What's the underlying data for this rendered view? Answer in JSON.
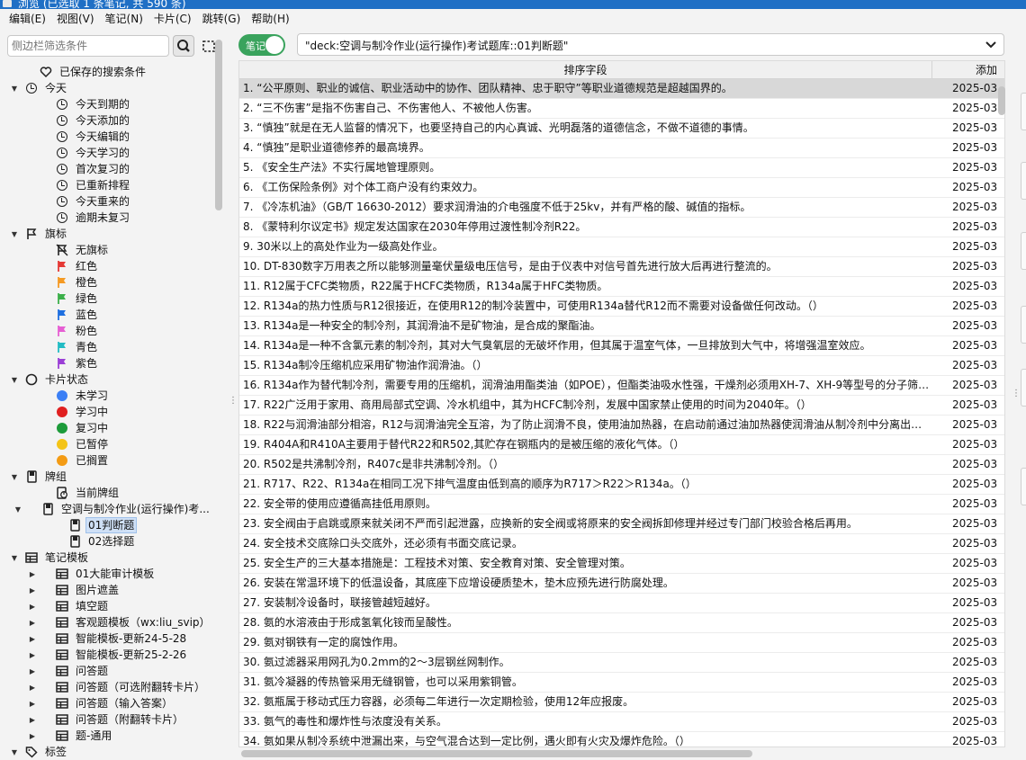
{
  "window": {
    "title": "浏览 (已选取 1 条笔记, 共 590 条)"
  },
  "menu": [
    "编辑(E)",
    "视图(V)",
    "笔记(N)",
    "卡片(C)",
    "跳转(G)",
    "帮助(H)"
  ],
  "sidebar": {
    "search_placeholder": "侧边栏筛选条件",
    "items": [
      {
        "label": "已保存的搜索条件",
        "icon": "heart-icon",
        "arrow": ""
      },
      {
        "label": "今天",
        "icon": "clock-icon",
        "arrow": "down"
      },
      {
        "label": "今天到期的",
        "icon": "clock-icon",
        "arrow": ""
      },
      {
        "label": "今天添加的",
        "icon": "clock-icon",
        "arrow": ""
      },
      {
        "label": "今天编辑的",
        "icon": "clock-icon",
        "arrow": ""
      },
      {
        "label": "今天学习的",
        "icon": "clock-icon",
        "arrow": ""
      },
      {
        "label": "首次复习的",
        "icon": "clock-icon",
        "arrow": ""
      },
      {
        "label": "已重新排程",
        "icon": "clock-icon",
        "arrow": ""
      },
      {
        "label": "今天重来的",
        "icon": "clock-icon",
        "arrow": ""
      },
      {
        "label": "逾期未复习",
        "icon": "clock-icon",
        "arrow": ""
      },
      {
        "label": "旗标",
        "icon": "flag-outline-icon",
        "arrow": "down"
      },
      {
        "label": "无旗标",
        "icon": "flag-off-icon",
        "arrow": ""
      },
      {
        "label": "红色",
        "icon": "flag-red-icon",
        "arrow": "",
        "color": "#e53935"
      },
      {
        "label": "橙色",
        "icon": "flag-orange-icon",
        "arrow": "",
        "color": "#f59a23"
      },
      {
        "label": "绿色",
        "icon": "flag-green-icon",
        "arrow": "",
        "color": "#3cb04a"
      },
      {
        "label": "蓝色",
        "icon": "flag-blue-icon",
        "arrow": "",
        "color": "#1e6fe0"
      },
      {
        "label": "粉色",
        "icon": "flag-pink-icon",
        "arrow": "",
        "color": "#e65fd3"
      },
      {
        "label": "青色",
        "icon": "flag-cyan-icon",
        "arrow": "",
        "color": "#22bcc4"
      },
      {
        "label": "紫色",
        "icon": "flag-purple-icon",
        "arrow": "",
        "color": "#9b3fd6"
      },
      {
        "label": "卡片状态",
        "icon": "circle-icon",
        "arrow": "down"
      },
      {
        "label": "未学习",
        "icon": "dot-blue-icon",
        "arrow": "",
        "color": "#3b7ff5"
      },
      {
        "label": "学习中",
        "icon": "dot-red-icon",
        "arrow": "",
        "color": "#e02020"
      },
      {
        "label": "复习中",
        "icon": "dot-green-icon",
        "arrow": "",
        "color": "#1d9b3a"
      },
      {
        "label": "已暂停",
        "icon": "dot-yellow-icon",
        "arrow": "",
        "color": "#f4c417"
      },
      {
        "label": "已搁置",
        "icon": "dot-orange-icon",
        "arrow": "",
        "color": "#f39b14"
      },
      {
        "label": "牌组",
        "icon": "deck-icon",
        "arrow": "down"
      },
      {
        "label": "当前牌组",
        "icon": "current-deck-icon",
        "arrow": ""
      },
      {
        "label": "空调与制冷作业(运行操作)考...",
        "icon": "deck-icon",
        "arrow": "down"
      },
      {
        "label": "01判断题",
        "icon": "deck-icon",
        "arrow": "",
        "selected": true
      },
      {
        "label": "02选择题",
        "icon": "deck-icon",
        "arrow": ""
      },
      {
        "label": "笔记模板",
        "icon": "notetype-icon",
        "arrow": "down"
      },
      {
        "label": "01大能审计模板",
        "icon": "notetype-icon",
        "arrow": "right"
      },
      {
        "label": "图片遮盖",
        "icon": "notetype-icon",
        "arrow": "right"
      },
      {
        "label": "填空题",
        "icon": "notetype-icon",
        "arrow": "right"
      },
      {
        "label": "客观题模板（wx:liu_svip）",
        "icon": "notetype-icon",
        "arrow": "right"
      },
      {
        "label": "智能模板-更新24-5-28",
        "icon": "notetype-icon",
        "arrow": "right"
      },
      {
        "label": "智能模板-更新25-2-26",
        "icon": "notetype-icon",
        "arrow": "right"
      },
      {
        "label": "问答题",
        "icon": "notetype-icon",
        "arrow": "right"
      },
      {
        "label": "问答题（可选附翻转卡片）",
        "icon": "notetype-icon",
        "arrow": "right"
      },
      {
        "label": "问答题（输入答案）",
        "icon": "notetype-icon",
        "arrow": "right"
      },
      {
        "label": "问答题（附翻转卡片）",
        "icon": "notetype-icon",
        "arrow": "right"
      },
      {
        "label": "题-通用",
        "icon": "notetype-icon",
        "arrow": "right"
      },
      {
        "label": "标签",
        "icon": "tag-icon",
        "arrow": "down"
      }
    ]
  },
  "toolbar": {
    "mode_label": "笔记",
    "search_value": "\"deck:空调与制冷作业(运行操作)考试题库::01判断题\""
  },
  "table": {
    "columns": [
      "排序字段",
      "添加"
    ],
    "rows": [
      {
        "sort": "1. “公平原则、职业的诚信、职业活动中的协作、团队精神、忠于职守”等职业道德规范是超越国界的。",
        "added": "2025-03",
        "selected": true
      },
      {
        "sort": "2. “三不伤害”是指不伤害自己、不伤害他人、不被他人伤害。",
        "added": "2025-03"
      },
      {
        "sort": "3. “慎独”就是在无人监督的情况下，也要坚持自己的内心真诚、光明磊落的道德信念，不做不道德的事情。",
        "added": "2025-03"
      },
      {
        "sort": "4. “慎独”是职业道德修养的最高境界。",
        "added": "2025-03"
      },
      {
        "sort": "5. 《安全生产法》不实行属地管理原则。",
        "added": "2025-03"
      },
      {
        "sort": "6. 《工伤保险条例》对个体工商户没有约束效力。",
        "added": "2025-03"
      },
      {
        "sort": "7. 《冷冻机油》（GB/T 16630-2012）要求润滑油的介电强度不低于25kv，并有严格的酸、碱值的指标。",
        "added": "2025-03"
      },
      {
        "sort": "8. 《蒙特利尔议定书》规定发达国家在2030年停用过渡性制冷剂R22。",
        "added": "2025-03"
      },
      {
        "sort": "9. 30米以上的高处作业为一级高处作业。",
        "added": "2025-03"
      },
      {
        "sort": "10. DT-830数字万用表之所以能够测量毫伏量级电压信号，是由于仪表中对信号首先进行放大后再进行整流的。",
        "added": "2025-03"
      },
      {
        "sort": "11. R12属于CFC类物质，R22属于HCFC类物质，R134a属于HFC类物质。",
        "added": "2025-03"
      },
      {
        "sort": "12. R134a的热力性质与R12很接近，在使用R12的制冷装置中，可使用R134a替代R12而不需要对设备做任何改动。（）",
        "added": "2025-03"
      },
      {
        "sort": "13. R134a是一种安全的制冷剂，其润滑油不是矿物油，是合成的聚酯油。",
        "added": "2025-03"
      },
      {
        "sort": "14. R134a是一种不含氯元素的制冷剂，其对大气臭氧层的无破坏作用，但其属于温室气体，一旦排放到大气中，将增强温室效应。",
        "added": "2025-03"
      },
      {
        "sort": "15. R134a制冷压缩机应采用矿物油作润滑油。（）",
        "added": "2025-03"
      },
      {
        "sort": "16. R134a作为替代制冷剂，需要专用的压缩机，润滑油用酯类油（如POE），但酯类油吸水性强，干燥剂必须用XH-7、XH-9等型号的分子筛…",
        "added": "2025-03"
      },
      {
        "sort": "17. R22广泛用于家用、商用局部式空调、冷水机组中，其为HCFC制冷剂，发展中国家禁止使用的时间为2040年。（）",
        "added": "2025-03"
      },
      {
        "sort": "18. R22与润滑油部分相溶，R12与润滑油完全互溶，为了防止润滑不良，使用油加热器，在启动前通过油加热器使润滑油从制冷剂中分离出来。",
        "added": "2025-03"
      },
      {
        "sort": "19. R404A和R410A主要用于替代R22和R502,其贮存在钢瓶内的是被压缩的液化气体。（）",
        "added": "2025-03"
      },
      {
        "sort": "20. R502是共沸制冷剂，R407c是非共沸制冷剂。（）",
        "added": "2025-03"
      },
      {
        "sort": "21. R717、R22、R134a在相同工况下排气温度由低到高的顺序为R717＞R22＞R134a。（）",
        "added": "2025-03"
      },
      {
        "sort": "22. 安全带的使用应遵循高挂低用原则。",
        "added": "2025-03"
      },
      {
        "sort": "23. 安全阀由于启跳或原来就关闭不严而引起泄露，应换新的安全阀或将原来的安全阀拆卸修理并经过专门部门校验合格后再用。",
        "added": "2025-03"
      },
      {
        "sort": "24. 安全技术交底除口头交底外，还必须有书面交底记录。",
        "added": "2025-03"
      },
      {
        "sort": "25. 安全生产的三大基本措施是：工程技术对策、安全教育对策、安全管理对策。",
        "added": "2025-03"
      },
      {
        "sort": "26. 安装在常温环境下的低温设备，其底座下应增设硬质垫木，垫木应预先进行防腐处理。",
        "added": "2025-03"
      },
      {
        "sort": "27. 安装制冷设备时，联接管越短越好。",
        "added": "2025-03"
      },
      {
        "sort": "28. 氨的水溶液由于形成氢氧化铵而呈酸性。",
        "added": "2025-03"
      },
      {
        "sort": "29. 氨对钢铁有一定的腐蚀作用。",
        "added": "2025-03"
      },
      {
        "sort": "30. 氨过滤器采用网孔为0.2mm的2～3层钢丝网制作。",
        "added": "2025-03"
      },
      {
        "sort": "31. 氨冷凝器的传热管采用无缝钢管，也可以采用紫铜管。",
        "added": "2025-03"
      },
      {
        "sort": "32. 氨瓶属于移动式压力容器，必须每二年进行一次定期检验，使用12年应报废。",
        "added": "2025-03"
      },
      {
        "sort": "33. 氨气的毒性和爆炸性与浓度没有关系。",
        "added": "2025-03"
      },
      {
        "sort": "34. 氨如果从制冷系统中泄漏出来，与空气混合达到一定比例，遇火即有火灾及爆炸危险。（）",
        "added": "2025-03"
      }
    ]
  }
}
